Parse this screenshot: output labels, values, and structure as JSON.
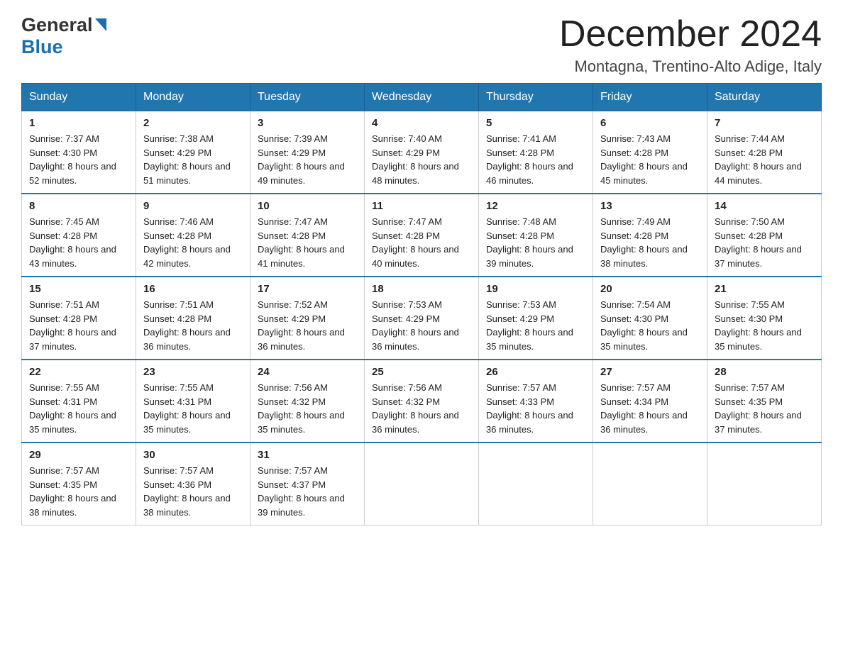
{
  "header": {
    "logo_general": "General",
    "logo_blue": "Blue",
    "month_title": "December 2024",
    "location": "Montagna, Trentino-Alto Adige, Italy"
  },
  "days_of_week": [
    "Sunday",
    "Monday",
    "Tuesday",
    "Wednesday",
    "Thursday",
    "Friday",
    "Saturday"
  ],
  "weeks": [
    [
      {
        "num": "1",
        "sunrise": "7:37 AM",
        "sunset": "4:30 PM",
        "daylight": "8 hours and 52 minutes."
      },
      {
        "num": "2",
        "sunrise": "7:38 AM",
        "sunset": "4:29 PM",
        "daylight": "8 hours and 51 minutes."
      },
      {
        "num": "3",
        "sunrise": "7:39 AM",
        "sunset": "4:29 PM",
        "daylight": "8 hours and 49 minutes."
      },
      {
        "num": "4",
        "sunrise": "7:40 AM",
        "sunset": "4:29 PM",
        "daylight": "8 hours and 48 minutes."
      },
      {
        "num": "5",
        "sunrise": "7:41 AM",
        "sunset": "4:28 PM",
        "daylight": "8 hours and 46 minutes."
      },
      {
        "num": "6",
        "sunrise": "7:43 AM",
        "sunset": "4:28 PM",
        "daylight": "8 hours and 45 minutes."
      },
      {
        "num": "7",
        "sunrise": "7:44 AM",
        "sunset": "4:28 PM",
        "daylight": "8 hours and 44 minutes."
      }
    ],
    [
      {
        "num": "8",
        "sunrise": "7:45 AM",
        "sunset": "4:28 PM",
        "daylight": "8 hours and 43 minutes."
      },
      {
        "num": "9",
        "sunrise": "7:46 AM",
        "sunset": "4:28 PM",
        "daylight": "8 hours and 42 minutes."
      },
      {
        "num": "10",
        "sunrise": "7:47 AM",
        "sunset": "4:28 PM",
        "daylight": "8 hours and 41 minutes."
      },
      {
        "num": "11",
        "sunrise": "7:47 AM",
        "sunset": "4:28 PM",
        "daylight": "8 hours and 40 minutes."
      },
      {
        "num": "12",
        "sunrise": "7:48 AM",
        "sunset": "4:28 PM",
        "daylight": "8 hours and 39 minutes."
      },
      {
        "num": "13",
        "sunrise": "7:49 AM",
        "sunset": "4:28 PM",
        "daylight": "8 hours and 38 minutes."
      },
      {
        "num": "14",
        "sunrise": "7:50 AM",
        "sunset": "4:28 PM",
        "daylight": "8 hours and 37 minutes."
      }
    ],
    [
      {
        "num": "15",
        "sunrise": "7:51 AM",
        "sunset": "4:28 PM",
        "daylight": "8 hours and 37 minutes."
      },
      {
        "num": "16",
        "sunrise": "7:51 AM",
        "sunset": "4:28 PM",
        "daylight": "8 hours and 36 minutes."
      },
      {
        "num": "17",
        "sunrise": "7:52 AM",
        "sunset": "4:29 PM",
        "daylight": "8 hours and 36 minutes."
      },
      {
        "num": "18",
        "sunrise": "7:53 AM",
        "sunset": "4:29 PM",
        "daylight": "8 hours and 36 minutes."
      },
      {
        "num": "19",
        "sunrise": "7:53 AM",
        "sunset": "4:29 PM",
        "daylight": "8 hours and 35 minutes."
      },
      {
        "num": "20",
        "sunrise": "7:54 AM",
        "sunset": "4:30 PM",
        "daylight": "8 hours and 35 minutes."
      },
      {
        "num": "21",
        "sunrise": "7:55 AM",
        "sunset": "4:30 PM",
        "daylight": "8 hours and 35 minutes."
      }
    ],
    [
      {
        "num": "22",
        "sunrise": "7:55 AM",
        "sunset": "4:31 PM",
        "daylight": "8 hours and 35 minutes."
      },
      {
        "num": "23",
        "sunrise": "7:55 AM",
        "sunset": "4:31 PM",
        "daylight": "8 hours and 35 minutes."
      },
      {
        "num": "24",
        "sunrise": "7:56 AM",
        "sunset": "4:32 PM",
        "daylight": "8 hours and 35 minutes."
      },
      {
        "num": "25",
        "sunrise": "7:56 AM",
        "sunset": "4:32 PM",
        "daylight": "8 hours and 36 minutes."
      },
      {
        "num": "26",
        "sunrise": "7:57 AM",
        "sunset": "4:33 PM",
        "daylight": "8 hours and 36 minutes."
      },
      {
        "num": "27",
        "sunrise": "7:57 AM",
        "sunset": "4:34 PM",
        "daylight": "8 hours and 36 minutes."
      },
      {
        "num": "28",
        "sunrise": "7:57 AM",
        "sunset": "4:35 PM",
        "daylight": "8 hours and 37 minutes."
      }
    ],
    [
      {
        "num": "29",
        "sunrise": "7:57 AM",
        "sunset": "4:35 PM",
        "daylight": "8 hours and 38 minutes."
      },
      {
        "num": "30",
        "sunrise": "7:57 AM",
        "sunset": "4:36 PM",
        "daylight": "8 hours and 38 minutes."
      },
      {
        "num": "31",
        "sunrise": "7:57 AM",
        "sunset": "4:37 PM",
        "daylight": "8 hours and 39 minutes."
      },
      null,
      null,
      null,
      null
    ]
  ]
}
